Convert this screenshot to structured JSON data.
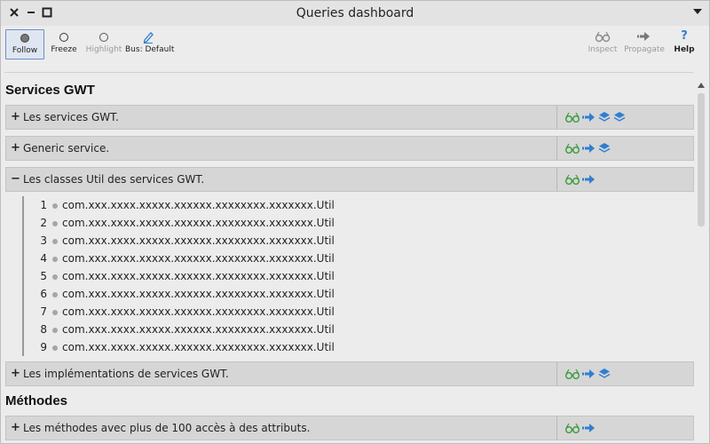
{
  "window": {
    "title": "Queries dashboard"
  },
  "toolbar": {
    "follow": "Follow",
    "freeze": "Freeze",
    "highlight": "Highlight",
    "bus": "Bus: Default",
    "inspect": "Inspect",
    "propagate": "Propagate",
    "help": "Help"
  },
  "sections": [
    {
      "title": "Services GWT"
    },
    {
      "title": "Méthodes"
    }
  ],
  "queries": [
    {
      "toggle": "+",
      "label": "Les services GWT.",
      "actions": [
        "glasses-icon",
        "arrow-icon",
        "layers-icon",
        "layers-icon"
      ]
    },
    {
      "toggle": "+",
      "label": "Generic service.",
      "actions": [
        "glasses-icon",
        "arrow-icon",
        "layers-icon"
      ]
    },
    {
      "toggle": "−",
      "label": "Les classes Util des services GWT.",
      "actions": [
        "glasses-icon",
        "arrow-icon"
      ]
    },
    {
      "toggle": "+",
      "label": "Les implémentations de services GWT.",
      "actions": [
        "glasses-icon",
        "arrow-icon",
        "layers-icon"
      ]
    },
    {
      "toggle": "+",
      "label": "Les méthodes avec plus de 100 accès à des attributs.",
      "actions": [
        "glasses-icon",
        "arrow-icon"
      ]
    }
  ],
  "results": [
    {
      "num": "1",
      "text": "com.xxx.xxxx.xxxxx.xxxxxx.xxxxxxxx.xxxxxxx.Util"
    },
    {
      "num": "2",
      "text": "com.xxx.xxxx.xxxxx.xxxxxx.xxxxxxxx.xxxxxxx.Util"
    },
    {
      "num": "3",
      "text": "com.xxx.xxxx.xxxxx.xxxxxx.xxxxxxxx.xxxxxxx.Util"
    },
    {
      "num": "4",
      "text": "com.xxx.xxxx.xxxxx.xxxxxx.xxxxxxxx.xxxxxxx.Util"
    },
    {
      "num": "5",
      "text": "com.xxx.xxxx.xxxxx.xxxxxx.xxxxxxxx.xxxxxxx.Util"
    },
    {
      "num": "6",
      "text": "com.xxx.xxxx.xxxxx.xxxxxx.xxxxxxxx.xxxxxxx.Util"
    },
    {
      "num": "7",
      "text": "com.xxx.xxxx.xxxxx.xxxxxx.xxxxxxxx.xxxxxxx.Util"
    },
    {
      "num": "8",
      "text": "com.xxx.xxxx.xxxxx.xxxxxx.xxxxxxxx.xxxxxxx.Util"
    },
    {
      "num": "9",
      "text": "com.xxx.xxxx.xxxxx.xxxxxx.xxxxxxxx.xxxxxxx.Util"
    }
  ],
  "colors": {
    "accent": "#2f7fd1",
    "glasses": "#3a9a3a",
    "toolbar_active": "#dfe6f2"
  }
}
